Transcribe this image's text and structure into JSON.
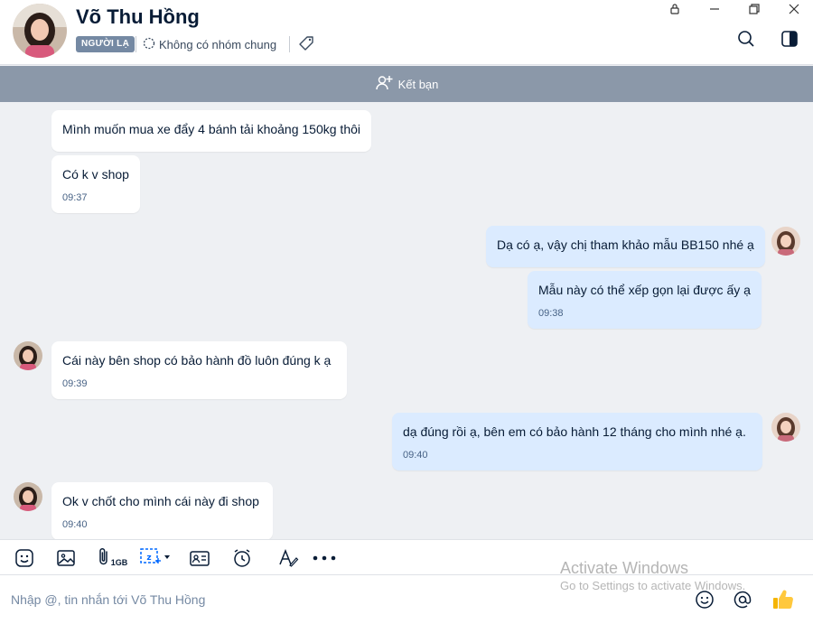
{
  "header": {
    "contact_name": "Võ Thu Hồng",
    "stranger_tag": "NGƯỜI LẠ",
    "group_info": "Không có nhóm chung"
  },
  "friend_bar": {
    "label": "Kết bạn"
  },
  "messages": [
    {
      "side": "in",
      "text": "Mình muốn mua xe đẩy 4 bánh tải khoảng 150kg thôi",
      "time": ""
    },
    {
      "side": "in",
      "text": "Có k v shop",
      "time": "09:37"
    },
    {
      "side": "out",
      "text": "Dạ có ạ, vậy chị tham khảo mẫu BB150 nhé ạ",
      "time": ""
    },
    {
      "side": "out",
      "text": "Mẫu này có thể xếp gọn lại được ấy ạ",
      "time": "09:38"
    },
    {
      "side": "in",
      "text": "Cái này bên shop có bảo hành đồ luôn đúng k ạ",
      "time": "09:39"
    },
    {
      "side": "out",
      "text": "dạ đúng rồi ạ, bên em có bảo hành 12 tháng cho mình nhé ạ.",
      "time": "09:40"
    },
    {
      "side": "in",
      "text": "Ok v chốt cho mình cái này đi shop",
      "time": "09:40"
    }
  ],
  "toolbar": {
    "file_limit": "1GB"
  },
  "input": {
    "placeholder": "Nhập @, tin nhắn tới Võ Thu Hồng"
  },
  "watermark": {
    "line1": "Activate Windows",
    "line2": "Go to Settings to activate Windows."
  },
  "colors": {
    "accent": "#0068ff",
    "outgoing_bubble": "#dbebff",
    "friend_bar": "#8b98a9",
    "stranger_tag": "#7589a3"
  }
}
